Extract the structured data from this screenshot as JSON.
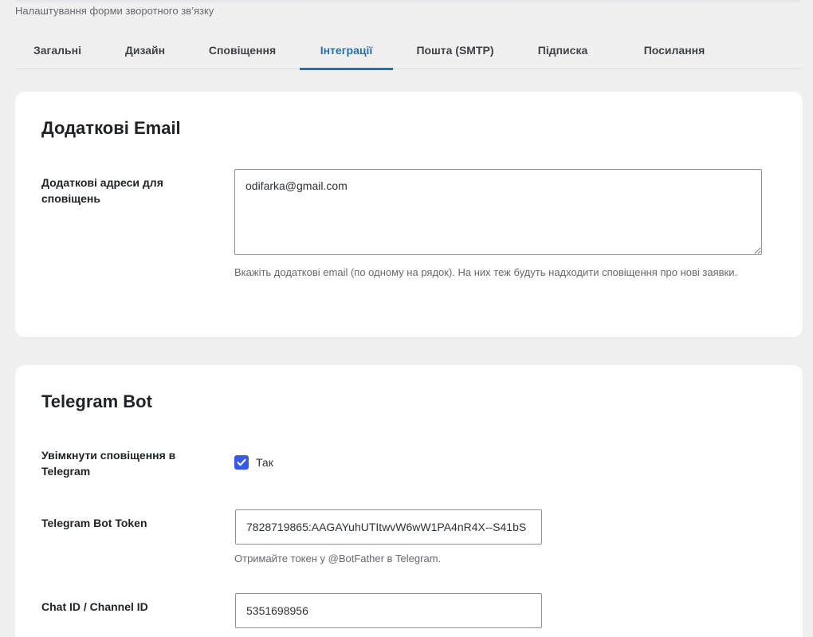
{
  "header": {
    "subtitle": "Налаштування форми зворотного зв’язку"
  },
  "tabs": [
    {
      "label": "Загальні",
      "active": false
    },
    {
      "label": "Дизайн",
      "active": false
    },
    {
      "label": "Сповіщення",
      "active": false
    },
    {
      "label": "Інтеграції",
      "active": true
    },
    {
      "label": "Пошта (SMTP)",
      "active": false
    },
    {
      "label": "Підписка",
      "active": false
    },
    {
      "label": "Посилання",
      "active": false
    }
  ],
  "email_section": {
    "title": "Додаткові Email",
    "addresses_label": "Додаткові адреси для сповіщень",
    "addresses_value": "odifarka@gmail.com",
    "help": "Вкажіть додаткові email (по одному на рядок). На них теж будуть надходити сповіщення про нові заявки."
  },
  "telegram_section": {
    "title": "Telegram Bot",
    "enable_label": "Увімкнути сповіщення в Telegram",
    "enable_checkbox_label": "Так",
    "enable_checked": true,
    "token_label": "Telegram Bot Token",
    "token_value": "7828719865:AAGAYuhUTItwvW6wW1PA4nR4X--S41bS",
    "token_help": "Отримайте токен у @BotFather в Telegram.",
    "chat_label": "Chat ID / Channel ID",
    "chat_value": "5351698956"
  },
  "colors": {
    "accent": "#2271b1",
    "checkbox": "#3858e9",
    "background": "#f0f0f1"
  }
}
